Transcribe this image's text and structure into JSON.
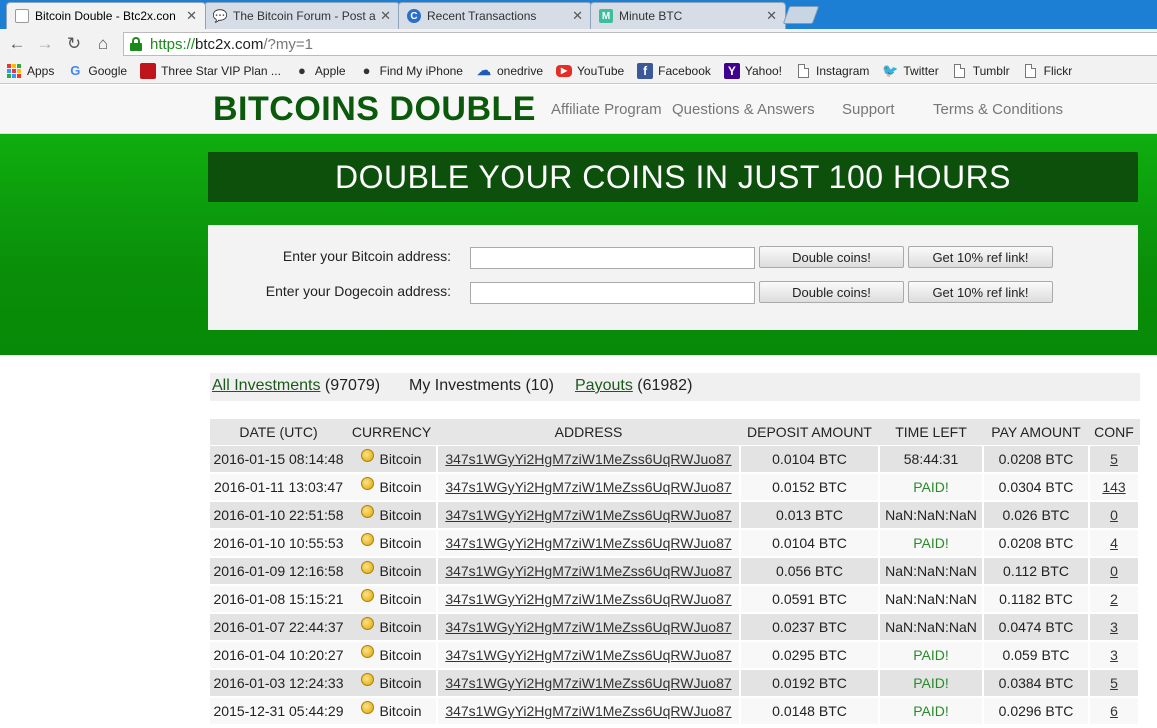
{
  "browser": {
    "tabs": [
      {
        "title": "Bitcoin Double - Btc2x.con",
        "active": true,
        "favicon": "bitcoin-double-favicon"
      },
      {
        "title": "The Bitcoin Forum - Post a",
        "active": false,
        "favicon": "forum-chat-icon"
      },
      {
        "title": "Recent Transactions",
        "active": false,
        "favicon": "chrome-web-icon"
      },
      {
        "title": "Minute BTC",
        "active": false,
        "favicon": "minute-btc-m-icon"
      }
    ],
    "tab_close": "✕",
    "url": {
      "scheme": "https://",
      "host": "btc2x.com",
      "path": "/?my=1"
    },
    "bookmarks": [
      {
        "label": "Apps",
        "icon": "apps-grid-icon"
      },
      {
        "label": "Google",
        "icon": "google-g-icon"
      },
      {
        "label": "Three Star VIP Plan ...",
        "icon": "red-box-icon"
      },
      {
        "label": "Apple",
        "icon": "apple-icon"
      },
      {
        "label": "Find My iPhone",
        "icon": "apple-icon"
      },
      {
        "label": "onedrive",
        "icon": "cloud-icon"
      },
      {
        "label": "YouTube",
        "icon": "youtube-icon"
      },
      {
        "label": "Facebook",
        "icon": "facebook-icon"
      },
      {
        "label": "Yahoo!",
        "icon": "yahoo-icon"
      },
      {
        "label": "Instagram",
        "icon": "page-icon"
      },
      {
        "label": "Twitter",
        "icon": "twitter-bird-icon"
      },
      {
        "label": "Tumblr",
        "icon": "page-icon"
      },
      {
        "label": "Flickr",
        "icon": "page-icon"
      }
    ]
  },
  "site": {
    "logo": "BITCOINS DOUBLE",
    "nav": [
      "Affiliate Program",
      "Questions & Answers",
      "Support",
      "Terms & Conditions"
    ],
    "banner": "DOUBLE YOUR COINS IN JUST 100 HOURS",
    "forms": [
      {
        "label": "Enter your Bitcoin address:",
        "value": "",
        "double_btn": "Double coins!",
        "ref_btn": "Get 10% ref link!"
      },
      {
        "label": "Enter your Dogecoin address:",
        "value": "",
        "double_btn": "Double coins!",
        "ref_btn": "Get 10% ref link!"
      }
    ],
    "inv_tabs": [
      {
        "label": "All Investments",
        "count": " (97079)"
      },
      {
        "label": "My Investments",
        "count": " (10)"
      },
      {
        "label": "Payouts",
        "count": " (61982)"
      }
    ],
    "colors": {
      "brand_green": "#0b5a0b",
      "hero_green": "#0a8f0a",
      "paid_green": "#2a8a2a"
    }
  },
  "table": {
    "headers": [
      "DATE (UTC)",
      "CURRENCY",
      "ADDRESS",
      "DEPOSIT AMOUNT",
      "TIME LEFT",
      "PAY AMOUNT",
      "CONF"
    ],
    "rows": [
      {
        "date": "2016-01-15 08:14:48",
        "currency": "Bitcoin",
        "address": "347s1WGyYi2HgM7ziW1MeZss6UqRWJuo87",
        "deposit": "0.0104 BTC",
        "time_left": "58:44:31",
        "pay": "0.0208 BTC",
        "conf": "5"
      },
      {
        "date": "2016-01-11 13:03:47",
        "currency": "Bitcoin",
        "address": "347s1WGyYi2HgM7ziW1MeZss6UqRWJuo87",
        "deposit": "0.0152 BTC",
        "time_left": "PAID!",
        "pay": "0.0304 BTC",
        "conf": "143"
      },
      {
        "date": "2016-01-10 22:51:58",
        "currency": "Bitcoin",
        "address": "347s1WGyYi2HgM7ziW1MeZss6UqRWJuo87",
        "deposit": "0.013 BTC",
        "time_left": "NaN:NaN:NaN",
        "pay": "0.026 BTC",
        "conf": "0"
      },
      {
        "date": "2016-01-10 10:55:53",
        "currency": "Bitcoin",
        "address": "347s1WGyYi2HgM7ziW1MeZss6UqRWJuo87",
        "deposit": "0.0104 BTC",
        "time_left": "PAID!",
        "pay": "0.0208 BTC",
        "conf": "4"
      },
      {
        "date": "2016-01-09 12:16:58",
        "currency": "Bitcoin",
        "address": "347s1WGyYi2HgM7ziW1MeZss6UqRWJuo87",
        "deposit": "0.056 BTC",
        "time_left": "NaN:NaN:NaN",
        "pay": "0.112 BTC",
        "conf": "0"
      },
      {
        "date": "2016-01-08 15:15:21",
        "currency": "Bitcoin",
        "address": "347s1WGyYi2HgM7ziW1MeZss6UqRWJuo87",
        "deposit": "0.0591 BTC",
        "time_left": "NaN:NaN:NaN",
        "pay": "0.1182 BTC",
        "conf": "2"
      },
      {
        "date": "2016-01-07 22:44:37",
        "currency": "Bitcoin",
        "address": "347s1WGyYi2HgM7ziW1MeZss6UqRWJuo87",
        "deposit": "0.0237 BTC",
        "time_left": "NaN:NaN:NaN",
        "pay": "0.0474 BTC",
        "conf": "3"
      },
      {
        "date": "2016-01-04 10:20:27",
        "currency": "Bitcoin",
        "address": "347s1WGyYi2HgM7ziW1MeZss6UqRWJuo87",
        "deposit": "0.0295 BTC",
        "time_left": "PAID!",
        "pay": "0.059 BTC",
        "conf": "3"
      },
      {
        "date": "2016-01-03 12:24:33",
        "currency": "Bitcoin",
        "address": "347s1WGyYi2HgM7ziW1MeZss6UqRWJuo87",
        "deposit": "0.0192 BTC",
        "time_left": "PAID!",
        "pay": "0.0384 BTC",
        "conf": "5"
      },
      {
        "date": "2015-12-31 05:44:29",
        "currency": "Bitcoin",
        "address": "347s1WGyYi2HgM7ziW1MeZss6UqRWJuo87",
        "deposit": "0.0148 BTC",
        "time_left": "PAID!",
        "pay": "0.0296 BTC",
        "conf": "6"
      }
    ]
  }
}
